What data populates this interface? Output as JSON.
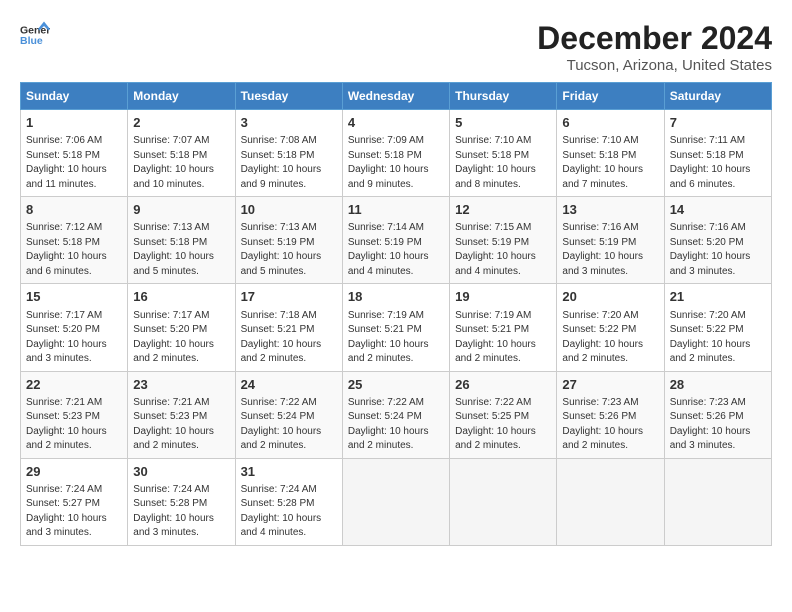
{
  "header": {
    "logo": {
      "text_general": "General",
      "text_blue": "Blue"
    },
    "month": "December 2024",
    "location": "Tucson, Arizona, United States"
  },
  "weekdays": [
    "Sunday",
    "Monday",
    "Tuesday",
    "Wednesday",
    "Thursday",
    "Friday",
    "Saturday"
  ],
  "weeks": [
    [
      {
        "day": 1,
        "sunrise": "7:06 AM",
        "sunset": "5:18 PM",
        "daylight": "10 hours and 11 minutes."
      },
      {
        "day": 2,
        "sunrise": "7:07 AM",
        "sunset": "5:18 PM",
        "daylight": "10 hours and 10 minutes."
      },
      {
        "day": 3,
        "sunrise": "7:08 AM",
        "sunset": "5:18 PM",
        "daylight": "10 hours and 9 minutes."
      },
      {
        "day": 4,
        "sunrise": "7:09 AM",
        "sunset": "5:18 PM",
        "daylight": "10 hours and 9 minutes."
      },
      {
        "day": 5,
        "sunrise": "7:10 AM",
        "sunset": "5:18 PM",
        "daylight": "10 hours and 8 minutes."
      },
      {
        "day": 6,
        "sunrise": "7:10 AM",
        "sunset": "5:18 PM",
        "daylight": "10 hours and 7 minutes."
      },
      {
        "day": 7,
        "sunrise": "7:11 AM",
        "sunset": "5:18 PM",
        "daylight": "10 hours and 6 minutes."
      }
    ],
    [
      {
        "day": 8,
        "sunrise": "7:12 AM",
        "sunset": "5:18 PM",
        "daylight": "10 hours and 6 minutes."
      },
      {
        "day": 9,
        "sunrise": "7:13 AM",
        "sunset": "5:18 PM",
        "daylight": "10 hours and 5 minutes."
      },
      {
        "day": 10,
        "sunrise": "7:13 AM",
        "sunset": "5:19 PM",
        "daylight": "10 hours and 5 minutes."
      },
      {
        "day": 11,
        "sunrise": "7:14 AM",
        "sunset": "5:19 PM",
        "daylight": "10 hours and 4 minutes."
      },
      {
        "day": 12,
        "sunrise": "7:15 AM",
        "sunset": "5:19 PM",
        "daylight": "10 hours and 4 minutes."
      },
      {
        "day": 13,
        "sunrise": "7:16 AM",
        "sunset": "5:19 PM",
        "daylight": "10 hours and 3 minutes."
      },
      {
        "day": 14,
        "sunrise": "7:16 AM",
        "sunset": "5:20 PM",
        "daylight": "10 hours and 3 minutes."
      }
    ],
    [
      {
        "day": 15,
        "sunrise": "7:17 AM",
        "sunset": "5:20 PM",
        "daylight": "10 hours and 3 minutes."
      },
      {
        "day": 16,
        "sunrise": "7:17 AM",
        "sunset": "5:20 PM",
        "daylight": "10 hours and 2 minutes."
      },
      {
        "day": 17,
        "sunrise": "7:18 AM",
        "sunset": "5:21 PM",
        "daylight": "10 hours and 2 minutes."
      },
      {
        "day": 18,
        "sunrise": "7:19 AM",
        "sunset": "5:21 PM",
        "daylight": "10 hours and 2 minutes."
      },
      {
        "day": 19,
        "sunrise": "7:19 AM",
        "sunset": "5:21 PM",
        "daylight": "10 hours and 2 minutes."
      },
      {
        "day": 20,
        "sunrise": "7:20 AM",
        "sunset": "5:22 PM",
        "daylight": "10 hours and 2 minutes."
      },
      {
        "day": 21,
        "sunrise": "7:20 AM",
        "sunset": "5:22 PM",
        "daylight": "10 hours and 2 minutes."
      }
    ],
    [
      {
        "day": 22,
        "sunrise": "7:21 AM",
        "sunset": "5:23 PM",
        "daylight": "10 hours and 2 minutes."
      },
      {
        "day": 23,
        "sunrise": "7:21 AM",
        "sunset": "5:23 PM",
        "daylight": "10 hours and 2 minutes."
      },
      {
        "day": 24,
        "sunrise": "7:22 AM",
        "sunset": "5:24 PM",
        "daylight": "10 hours and 2 minutes."
      },
      {
        "day": 25,
        "sunrise": "7:22 AM",
        "sunset": "5:24 PM",
        "daylight": "10 hours and 2 minutes."
      },
      {
        "day": 26,
        "sunrise": "7:22 AM",
        "sunset": "5:25 PM",
        "daylight": "10 hours and 2 minutes."
      },
      {
        "day": 27,
        "sunrise": "7:23 AM",
        "sunset": "5:26 PM",
        "daylight": "10 hours and 2 minutes."
      },
      {
        "day": 28,
        "sunrise": "7:23 AM",
        "sunset": "5:26 PM",
        "daylight": "10 hours and 3 minutes."
      }
    ],
    [
      {
        "day": 29,
        "sunrise": "7:24 AM",
        "sunset": "5:27 PM",
        "daylight": "10 hours and 3 minutes."
      },
      {
        "day": 30,
        "sunrise": "7:24 AM",
        "sunset": "5:28 PM",
        "daylight": "10 hours and 3 minutes."
      },
      {
        "day": 31,
        "sunrise": "7:24 AM",
        "sunset": "5:28 PM",
        "daylight": "10 hours and 4 minutes."
      },
      null,
      null,
      null,
      null
    ]
  ]
}
